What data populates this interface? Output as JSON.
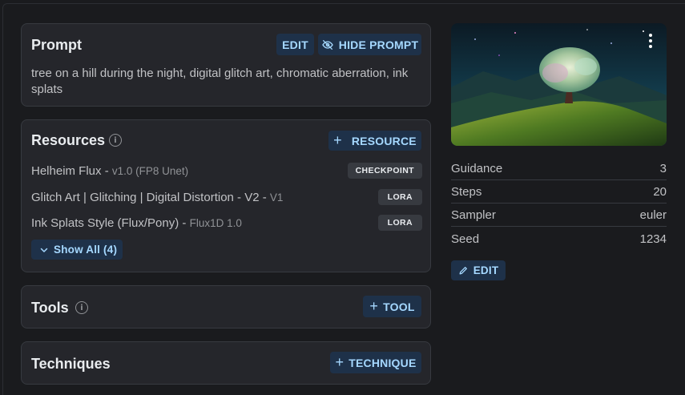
{
  "prompt_card": {
    "title": "Prompt",
    "edit_label": "EDIT",
    "hide_label": "HIDE PROMPT",
    "text": "tree on a hill during the night, digital glitch art, chromatic aberration, ink splats"
  },
  "resources_card": {
    "title": "Resources",
    "add_label": "RESOURCE",
    "items": [
      {
        "name": "Helheim Flux",
        "version": "v1.0 (FP8 Unet)",
        "badge": "CHECKPOINT"
      },
      {
        "name": "Glitch Art | Glitching | Digital Distortion - V2",
        "version": "V1",
        "badge": "LORA"
      },
      {
        "name": "Ink Splats Style (Flux/Pony)",
        "version": "Flux1D 1.0",
        "badge": "LORA"
      }
    ],
    "show_all_label": "Show All (4)"
  },
  "tools_card": {
    "title": "Tools",
    "add_label": "TOOL"
  },
  "techniques_card": {
    "title": "Techniques",
    "add_label": "TECHNIQUE"
  },
  "generation": {
    "stats": [
      {
        "label": "Guidance",
        "value": "3"
      },
      {
        "label": "Steps",
        "value": "20"
      },
      {
        "label": "Sampler",
        "value": "euler"
      },
      {
        "label": "Seed",
        "value": "1234"
      }
    ],
    "edit_label": "EDIT"
  },
  "colors": {
    "background": "#1a1b1e",
    "card": "#25262b",
    "button_bg": "#1e3149",
    "button_text": "#a5d8ff"
  }
}
